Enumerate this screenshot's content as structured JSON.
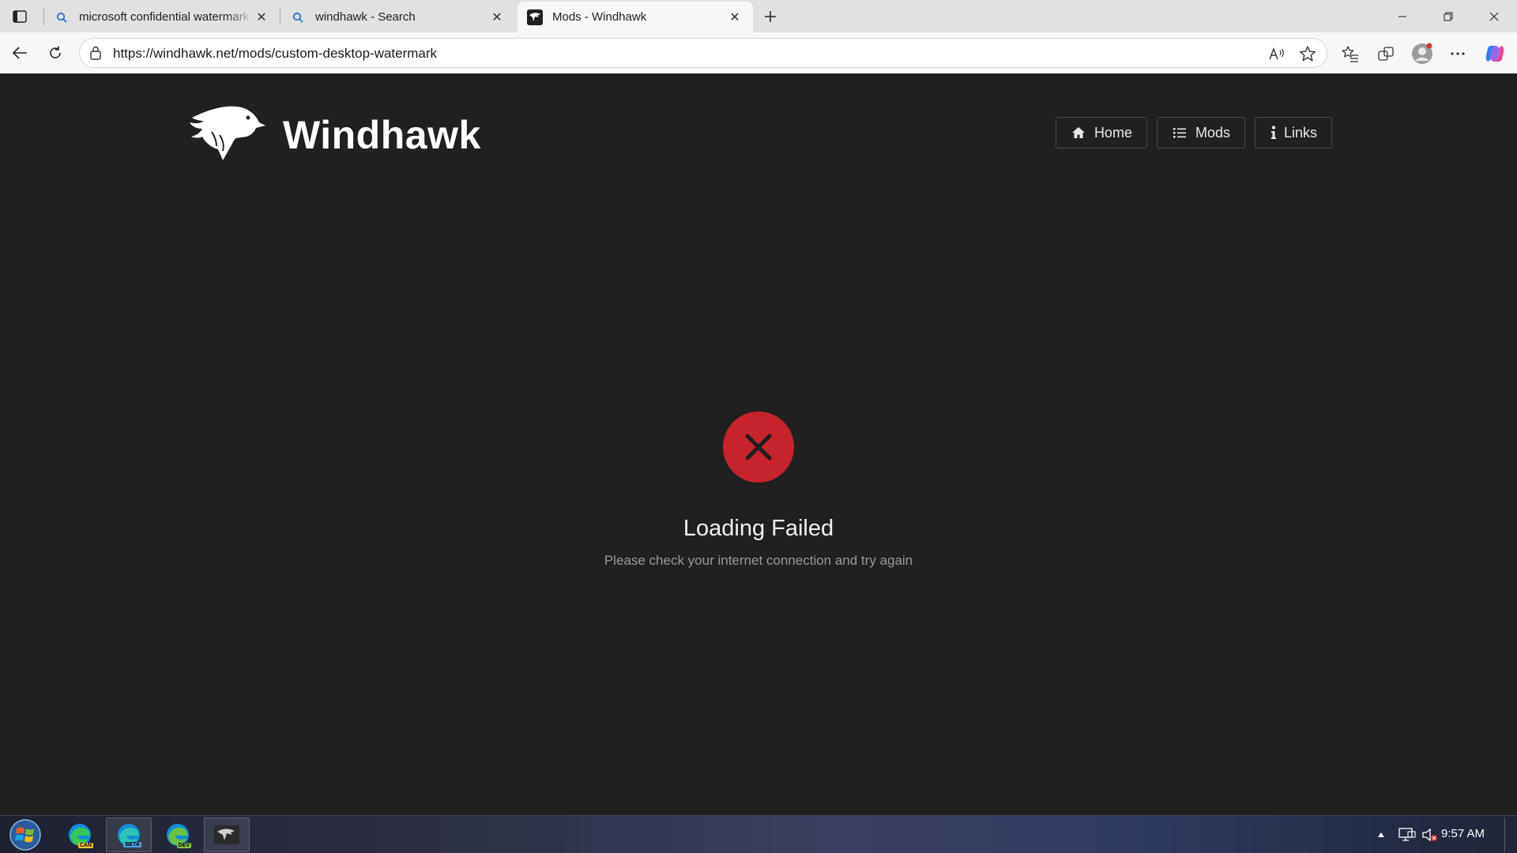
{
  "browser": {
    "tabs": [
      {
        "title": "microsoft confidential watermark",
        "icon": "search-icon",
        "active": false
      },
      {
        "title": "windhawk - Search",
        "icon": "search-icon",
        "active": false
      },
      {
        "title": "Mods - Windhawk",
        "icon": "windhawk-favicon",
        "active": true
      }
    ],
    "url": "https://windhawk.net/mods/custom-desktop-watermark"
  },
  "site": {
    "name": "Windhawk",
    "nav": [
      {
        "label": "Home",
        "icon": "home-icon"
      },
      {
        "label": "Mods",
        "icon": "list-icon"
      },
      {
        "label": "Links",
        "icon": "info-icon"
      }
    ]
  },
  "error": {
    "title": "Loading Failed",
    "message": "Please check your internet connection and try again",
    "color": "#c6232d"
  },
  "taskbar": {
    "apps": [
      {
        "name": "edge-canary",
        "badge": "CAN",
        "badge_color": "#f4c430",
        "running": false
      },
      {
        "name": "edge-beta",
        "badge": "BETA",
        "badge_color": "#4aa3df",
        "running": true
      },
      {
        "name": "edge-dev",
        "badge": "DEV",
        "badge_color": "#8bc34a",
        "running": false
      },
      {
        "name": "windhawk",
        "badge": "",
        "badge_color": "",
        "running": true
      }
    ],
    "clock": "9:57 AM"
  }
}
